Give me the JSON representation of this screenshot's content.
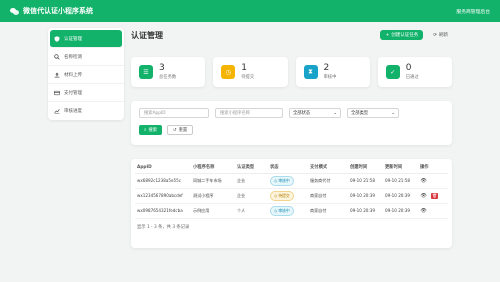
{
  "app": {
    "title": "微信代认证小程序系统",
    "right_link": "服务商管理后台"
  },
  "sidebar": {
    "items": [
      {
        "label": "认证管理",
        "icon": "shield-icon",
        "active": true
      },
      {
        "label": "名称检测",
        "icon": "search-icon",
        "active": false
      },
      {
        "label": "材料上传",
        "icon": "upload-icon",
        "active": false
      },
      {
        "label": "支付管理",
        "icon": "credit-card-icon",
        "active": false
      },
      {
        "label": "审核进度",
        "icon": "chart-line-icon",
        "active": false
      }
    ]
  },
  "header": {
    "title": "认证管理",
    "create_label": "创建认证任务",
    "refresh_label": "刷新"
  },
  "stats": [
    {
      "value": "3",
      "label": "总任务数",
      "color": "#13b26b",
      "icon": "list-icon"
    },
    {
      "value": "1",
      "label": "待提交",
      "color": "#f5b400",
      "icon": "clock-icon"
    },
    {
      "value": "2",
      "label": "审核中",
      "color": "#1aa3c8",
      "icon": "hourglass-icon"
    },
    {
      "value": "0",
      "label": "已通过",
      "color": "#13b26b",
      "icon": "check-icon"
    }
  ],
  "filter": {
    "appid_placeholder": "搜索AppID",
    "name_placeholder": "搜索小程序名称",
    "status_value": "全部状态",
    "type_value": "全部类型",
    "search_label": "搜索",
    "reset_label": "重置"
  },
  "table": {
    "headers": [
      "AppID",
      "小程序名称",
      "认证类型",
      "状态",
      "支付模式",
      "创建时间",
      "更新时间",
      "操作"
    ],
    "rows": [
      {
        "appid": "wx6892c1238a5e55c",
        "name": "同城二手车市场",
        "type": "企业",
        "status": "审核中",
        "status_kind": "review",
        "pay": "服务商代付",
        "created": "09-10 21:58",
        "updated": "09-10 21:58",
        "deletable": false
      },
      {
        "appid": "wx1234567890abcdef",
        "name": "测试小程序",
        "type": "企业",
        "status": "待提交",
        "status_kind": "pending",
        "pay": "商家自付",
        "created": "09-10 20:39",
        "updated": "09-10 20:39",
        "deletable": true
      },
      {
        "appid": "wx0987654321fedcba",
        "name": "示例应用",
        "type": "个人",
        "status": "审核中",
        "status_kind": "review",
        "pay": "商家自付",
        "created": "09-10 20:39",
        "updated": "09-10 20:39",
        "deletable": false
      }
    ],
    "footer": "显示 1 - 3 条，共 3 条记录"
  }
}
